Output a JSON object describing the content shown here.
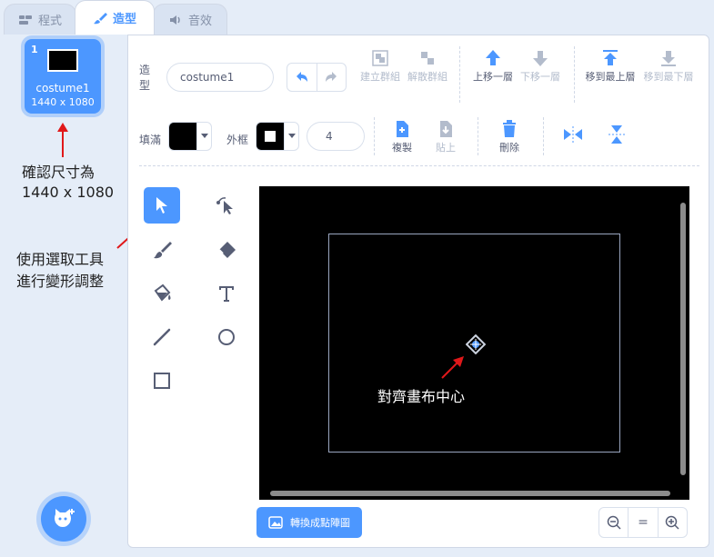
{
  "tabs": [
    {
      "label": "程式",
      "icon": "code-icon"
    },
    {
      "label": "造型",
      "icon": "brush-icon"
    },
    {
      "label": "音效",
      "icon": "sound-icon"
    }
  ],
  "costume": {
    "number": "1",
    "name": "costume1",
    "size": "1440 x 1080"
  },
  "annotations": {
    "size_note_line1": "確認尺寸為",
    "size_note_line2": "1440 x 1080",
    "select_note_line1": "使用選取工具",
    "select_note_line2": "進行變形調整",
    "center_note": "對齊畫布中心"
  },
  "editor": {
    "costume_label": "造型",
    "costume_name": "costume1",
    "fill_label": "填滿",
    "outline_label": "外框",
    "outline_width": "4",
    "fill_color": "#000000",
    "outline_color": "#000000",
    "toolbar": {
      "group": "建立群組",
      "ungroup": "解散群組",
      "forward": "上移一層",
      "backward": "下移一層",
      "front": "移到最上層",
      "back": "移到最下層",
      "copy": "複製",
      "paste": "貼上",
      "delete": "刪除"
    },
    "bitmap_button": "轉換成點陣圖",
    "zoom": {
      "out": "−",
      "reset": "=",
      "in": "+"
    }
  },
  "colors": {
    "accent": "#4c97ff",
    "annotation_arrow": "#e0181a"
  }
}
